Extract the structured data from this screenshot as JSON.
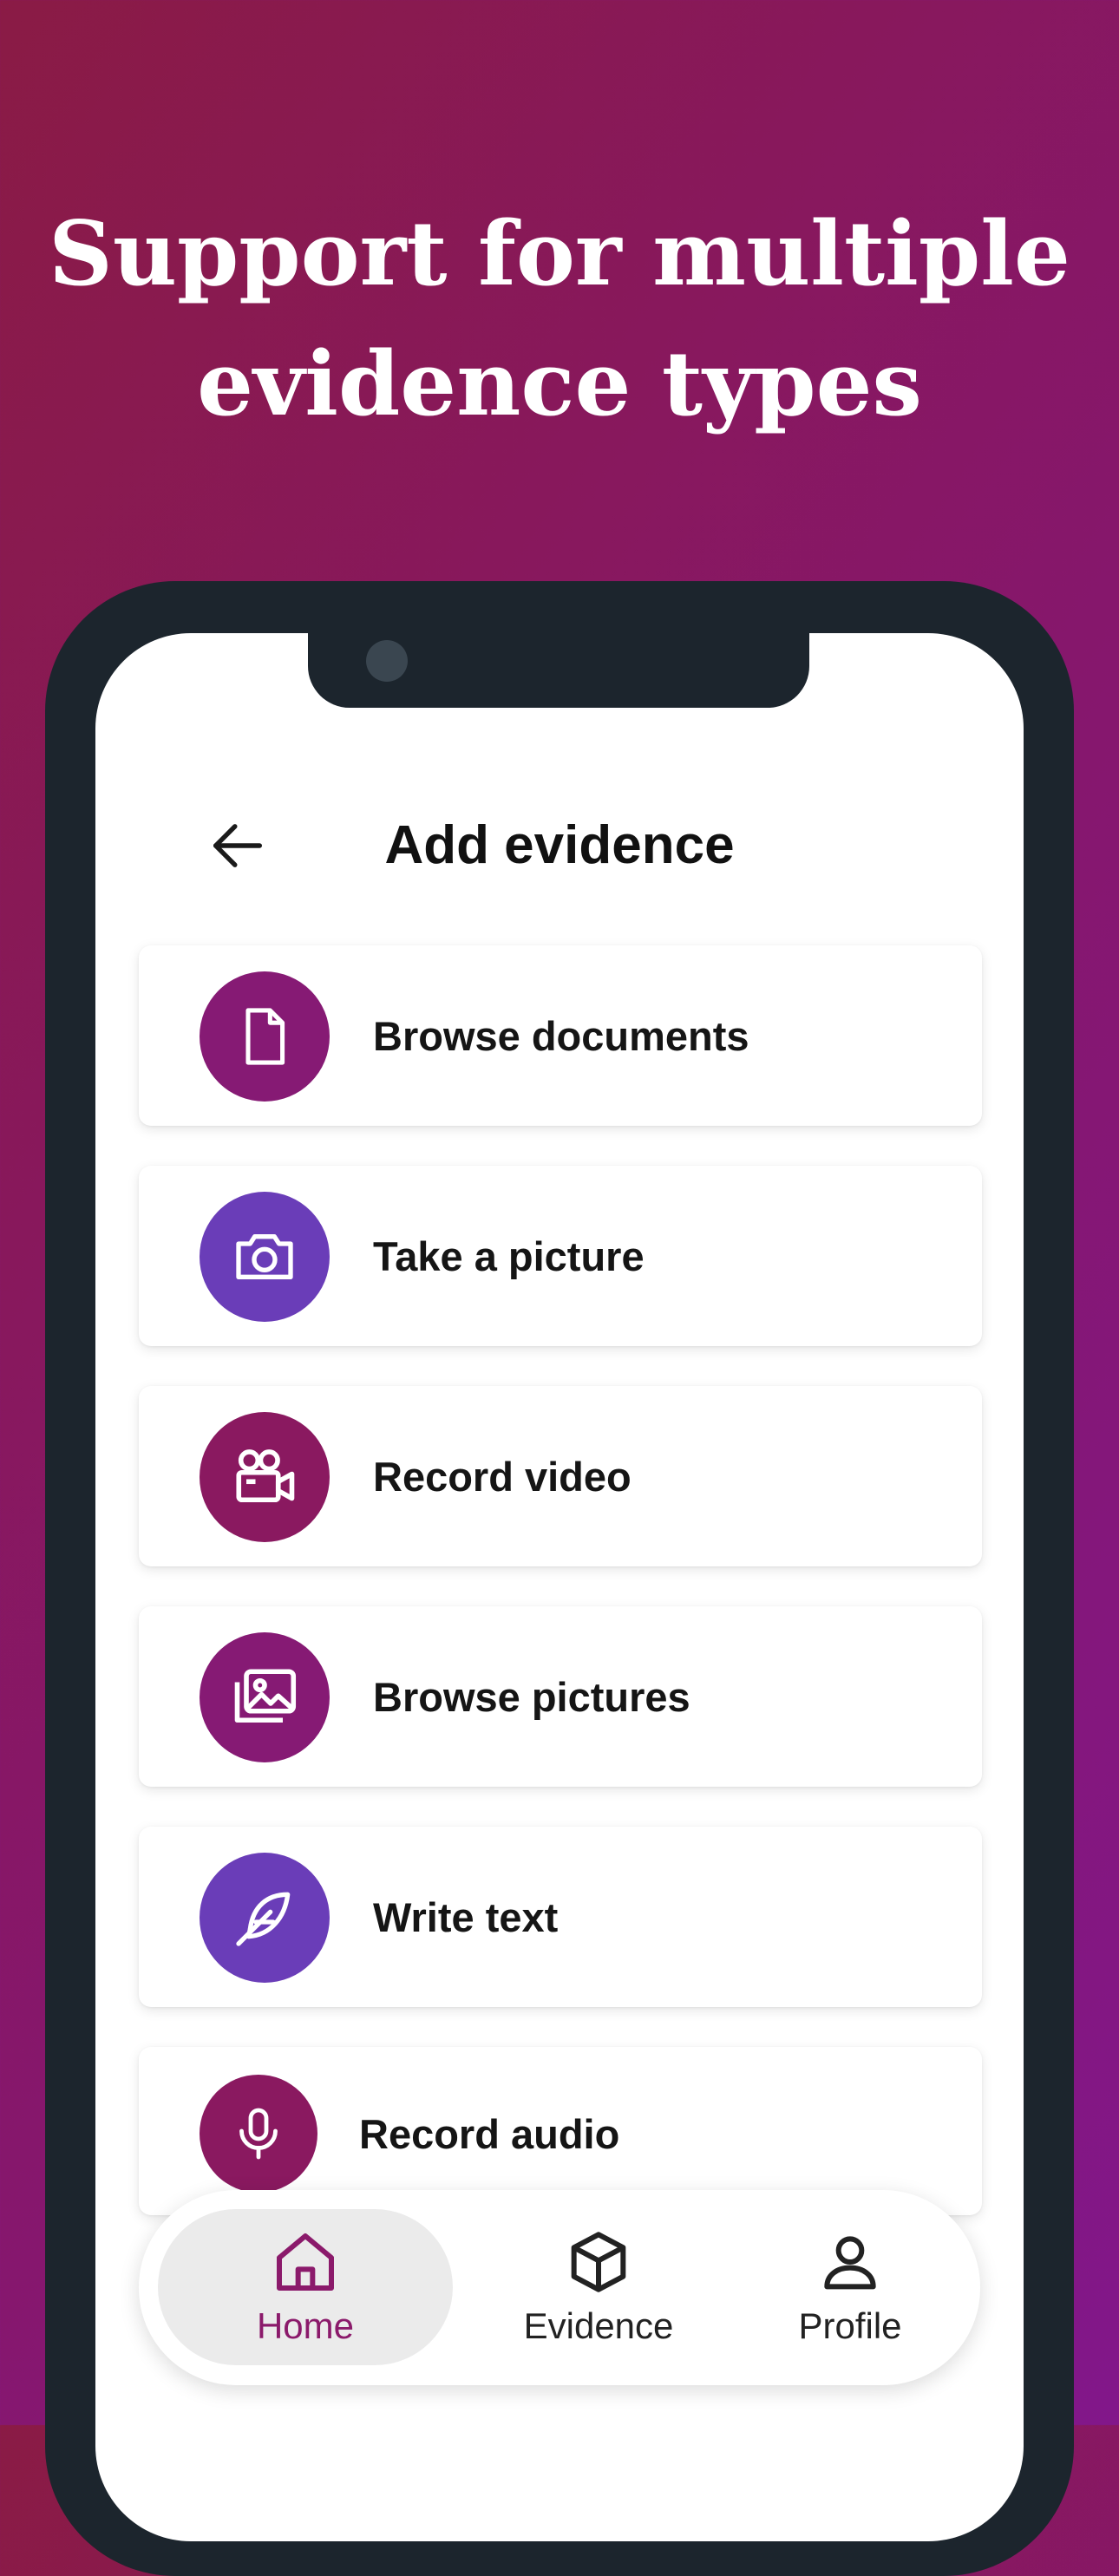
{
  "headline": {
    "line1": "Support for multiple",
    "line2": "evidence types"
  },
  "header": {
    "title": "Add evidence",
    "back_icon": "arrow-left-icon"
  },
  "options": [
    {
      "label": "Browse documents",
      "icon": "document-icon",
      "color": "#861a74"
    },
    {
      "label": "Take a picture",
      "icon": "camera-icon",
      "color": "#6a3db8"
    },
    {
      "label": "Record video",
      "icon": "video-camera-icon",
      "color": "#8a1960"
    },
    {
      "label": "Browse pictures",
      "icon": "image-gallery-icon",
      "color": "#861a74"
    },
    {
      "label": "Write text",
      "icon": "feather-icon",
      "color": "#6a3db8"
    },
    {
      "label": "Record audio",
      "icon": "microphone-icon",
      "color": "#8a1960"
    }
  ],
  "tabbar": {
    "active": "Home",
    "items": [
      {
        "label": "Home",
        "icon": "home-icon"
      },
      {
        "label": "Evidence",
        "icon": "cube-icon"
      },
      {
        "label": "Profile",
        "icon": "user-icon"
      }
    ]
  },
  "colors": {
    "accent": "#8b1a6b",
    "purple": "#6a3db8",
    "bezel": "#1c252d"
  }
}
